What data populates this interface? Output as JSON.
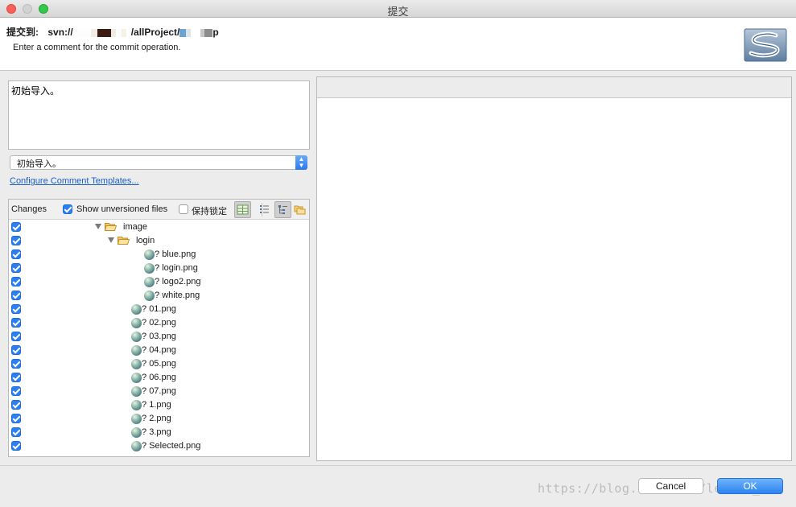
{
  "window": {
    "title": "提交"
  },
  "header": {
    "commit_to_label": "提交到:",
    "url_prefix": "svn://",
    "url_middle": "/allProject/",
    "url_suffix": "p",
    "description": "Enter a comment for the commit operation."
  },
  "comment": {
    "text": "初始导入。",
    "history_selected": "初始导入。",
    "configure_templates_link": "Configure Comment Templates..."
  },
  "changes": {
    "label": "Changes",
    "show_unversioned_label": "Show unversioned files",
    "show_unversioned_checked": true,
    "keep_locks_label": "保持锁定",
    "keep_locks_checked": false,
    "tree": [
      {
        "kind": "folder",
        "name": "image",
        "level": 0,
        "checked": true,
        "status": ""
      },
      {
        "kind": "folder",
        "name": "login",
        "level": 1,
        "checked": true,
        "status": ""
      },
      {
        "kind": "file",
        "name": "blue.png",
        "level": 2,
        "checked": true,
        "status": "?"
      },
      {
        "kind": "file",
        "name": "login.png",
        "level": 2,
        "checked": true,
        "status": "?"
      },
      {
        "kind": "file",
        "name": "logo2.png",
        "level": 2,
        "checked": true,
        "status": "?"
      },
      {
        "kind": "file",
        "name": "white.png",
        "level": 2,
        "checked": true,
        "status": "?"
      },
      {
        "kind": "file",
        "name": "01.png",
        "level": 1,
        "checked": true,
        "status": "?"
      },
      {
        "kind": "file",
        "name": "02.png",
        "level": 1,
        "checked": true,
        "status": "?"
      },
      {
        "kind": "file",
        "name": "03.png",
        "level": 1,
        "checked": true,
        "status": "?"
      },
      {
        "kind": "file",
        "name": "04.png",
        "level": 1,
        "checked": true,
        "status": "?"
      },
      {
        "kind": "file",
        "name": "05.png",
        "level": 1,
        "checked": true,
        "status": "?"
      },
      {
        "kind": "file",
        "name": "06.png",
        "level": 1,
        "checked": true,
        "status": "?"
      },
      {
        "kind": "file",
        "name": "07.png",
        "level": 1,
        "checked": true,
        "status": "?"
      },
      {
        "kind": "file",
        "name": "1.png",
        "level": 1,
        "checked": true,
        "status": "?"
      },
      {
        "kind": "file",
        "name": "2.png",
        "level": 1,
        "checked": true,
        "status": "?"
      },
      {
        "kind": "file",
        "name": "3.png",
        "level": 1,
        "checked": true,
        "status": "?"
      },
      {
        "kind": "file",
        "name": "Selected.png",
        "level": 1,
        "checked": true,
        "status": "?"
      }
    ]
  },
  "buttons": {
    "cancel": "Cancel",
    "ok": "OK"
  },
  "watermark": "https://blog.csdn.net/leslie_dw",
  "colors": {
    "accent": "#2b7ff0",
    "link": "#1a5fc9"
  },
  "icons": {
    "folder": "folder-open-icon",
    "file": "unversioned-file-icon",
    "logo": "subversion-logo"
  }
}
